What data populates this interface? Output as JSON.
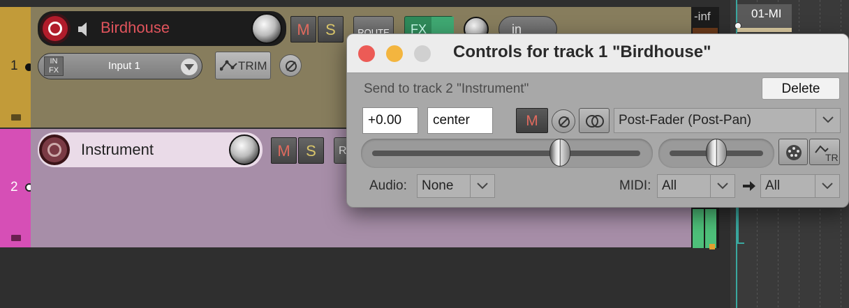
{
  "tracks": [
    {
      "number": "1",
      "name": "Birdhouse",
      "input": "Input 1",
      "color": "#877d5d",
      "strip_color": "#c29b39"
    },
    {
      "number": "2",
      "name": "Instrument",
      "color": "#a78ea8",
      "strip_color": "#d64fb6"
    }
  ],
  "track_buttons": {
    "mute": "M",
    "solo": "S",
    "route": "ROUTE",
    "fx": "FX",
    "in_fx_top": "IN",
    "in_fx_bottom": "FX",
    "trim": "TRIM",
    "input_mode": "in",
    "route_partial": "R"
  },
  "meter": {
    "peak": "-inf"
  },
  "timeline": {
    "item_label": "01-MI"
  },
  "dialog": {
    "title": "Controls for track 1 \"Birdhouse\"",
    "send_label": "Send to track 2 \"Instrument\"",
    "delete_label": "Delete",
    "volume_value": "+0.00",
    "pan_value": "center",
    "mute_label": "M",
    "send_mode": "Post-Fader (Post-Pan)",
    "tr_label": "TR",
    "audio_label": "Audio:",
    "audio_value": "None",
    "midi_label": "MIDI:",
    "midi_value": "All",
    "midi_dest_value": "All",
    "volume_level": 0.7,
    "pan_level": 0.5
  }
}
